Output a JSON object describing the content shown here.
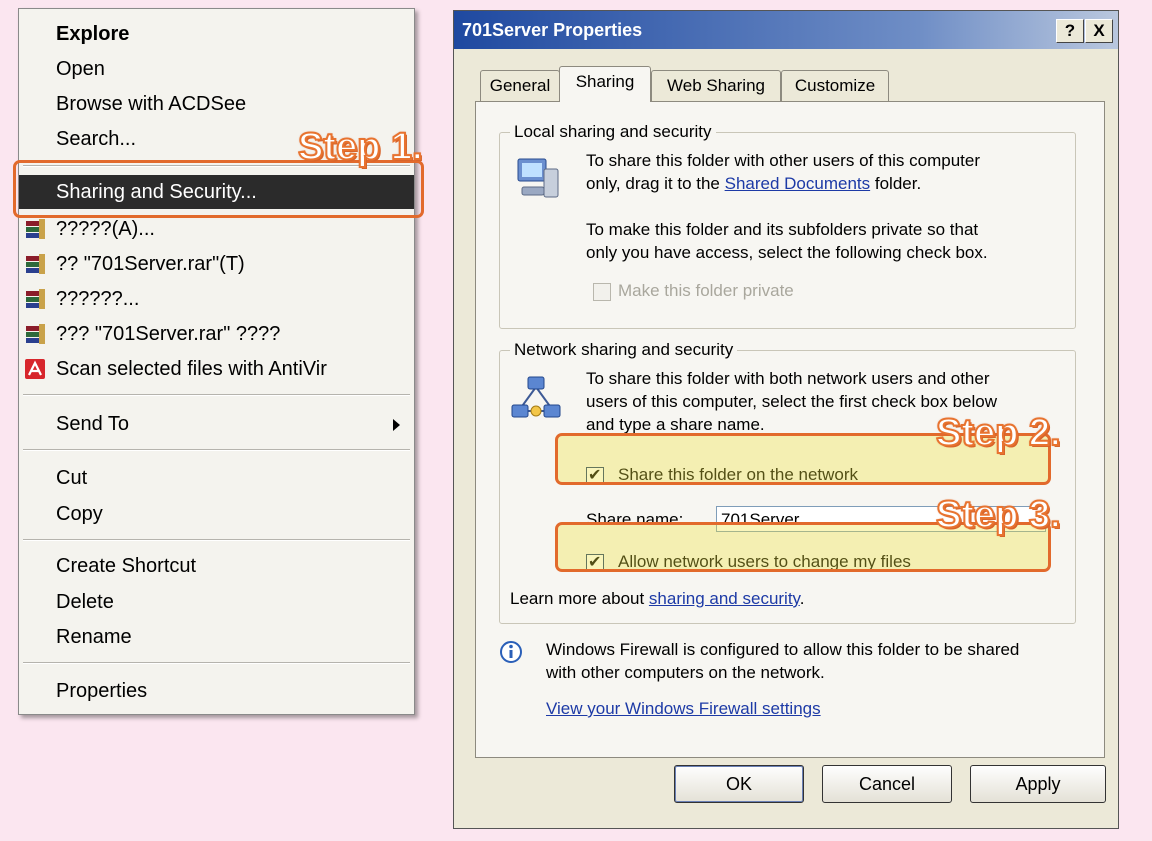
{
  "context_menu": {
    "items": [
      {
        "label": "Explore"
      },
      {
        "label": "Open"
      },
      {
        "label": "Browse with ACDSee"
      },
      {
        "label": "Search..."
      },
      {
        "label": "Sharing and Security..."
      },
      {
        "label": "?????(A)..."
      },
      {
        "label": "?? \"701Server.rar\"(T)"
      },
      {
        "label": "??????..."
      },
      {
        "label": "??? \"701Server.rar\" ????"
      },
      {
        "label": "Scan selected files with AntiVir"
      },
      {
        "label": "Send To"
      },
      {
        "label": "Cut"
      },
      {
        "label": "Copy"
      },
      {
        "label": "Create Shortcut"
      },
      {
        "label": "Delete"
      },
      {
        "label": "Rename"
      },
      {
        "label": "Properties"
      }
    ]
  },
  "callouts": {
    "step1": "Step 1.",
    "step2": "Step 2.",
    "step3": "Step 3."
  },
  "dialog": {
    "title": "701Server Properties",
    "help_btn": "?",
    "close_btn": "X",
    "tabs": [
      "General",
      "Sharing",
      "Web Sharing",
      "Customize"
    ],
    "local": {
      "legend": "Local sharing and security",
      "text1a": "To share this folder with other users of this computer",
      "text1b_pre": "only, drag it to the ",
      "text1b_link": "Shared Documents",
      "text1b_post": " folder.",
      "text2a": "To make this folder and its subfolders private so that",
      "text2b": "only you have access, select the following check box.",
      "private_checkbox": "Make this folder private"
    },
    "network": {
      "legend": "Network sharing and security",
      "text1": "To share this folder with both network users and other",
      "text2": "users of this computer, select the first check box below",
      "text3": "and type a share name.",
      "share_checkbox": "Share this folder on the network",
      "share_name_label": "Share name:",
      "share_name_value": "701Server",
      "allow_checkbox": "Allow network users to change my files",
      "learn_pre": "Learn more about ",
      "learn_link": "sharing and security",
      "learn_post": "."
    },
    "firewall": {
      "text1": "Windows Firewall is configured to allow this folder to be shared",
      "text2": "with other computers on the network.",
      "link": "View your Windows Firewall settings"
    },
    "buttons": {
      "ok": "OK",
      "cancel": "Cancel",
      "apply": "Apply"
    }
  }
}
